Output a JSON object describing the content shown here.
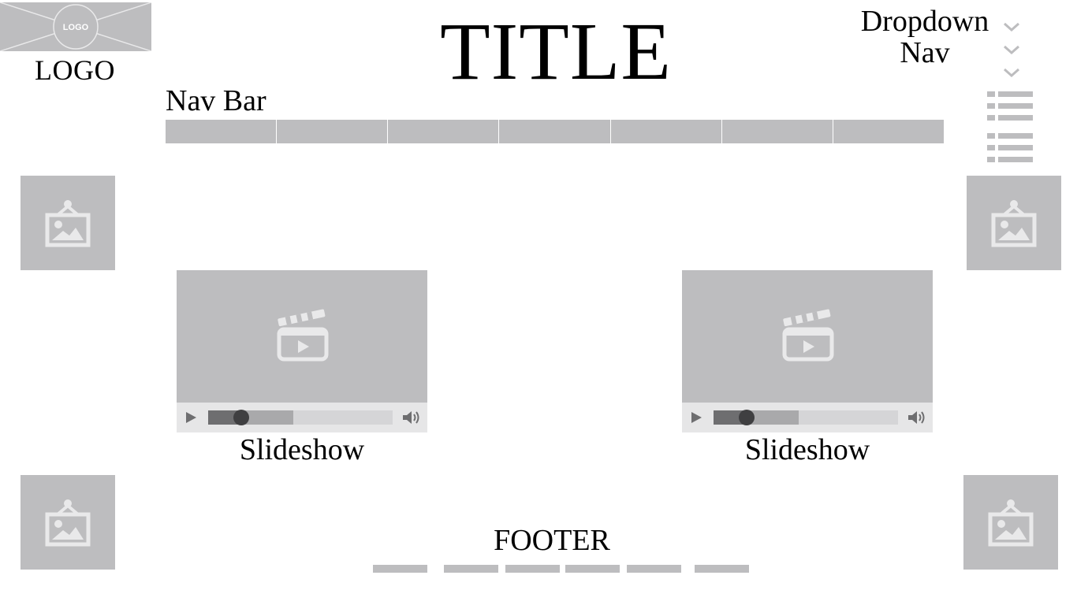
{
  "header": {
    "logo_badge": "LOGO",
    "logo_label": "LOGO",
    "title": "TITLE"
  },
  "dropdown_nav": {
    "label_line1": "Dropdown",
    "label_line2": "Nav",
    "chevron_icon": "chevron-down-icon"
  },
  "menu_icons": [
    "list-icon",
    "list-icon"
  ],
  "nav_bar": {
    "label": "Nav Bar",
    "segment_count": 7
  },
  "images": {
    "icon": "image-icon"
  },
  "slideshows": [
    {
      "caption": "Slideshow",
      "progress_played": 0.18,
      "progress_buffered": 0.46,
      "icon": "video-clapper-icon"
    },
    {
      "caption": "Slideshow",
      "progress_played": 0.18,
      "progress_buffered": 0.46,
      "icon": "video-clapper-icon"
    }
  ],
  "footer": {
    "label": "FOOTER",
    "link_count": 6
  },
  "colors": {
    "placeholder_gray": "#bdbdbf",
    "control_bar": "#e6e6e7",
    "icon_light": "#e9e9ea",
    "text": "#000000"
  }
}
